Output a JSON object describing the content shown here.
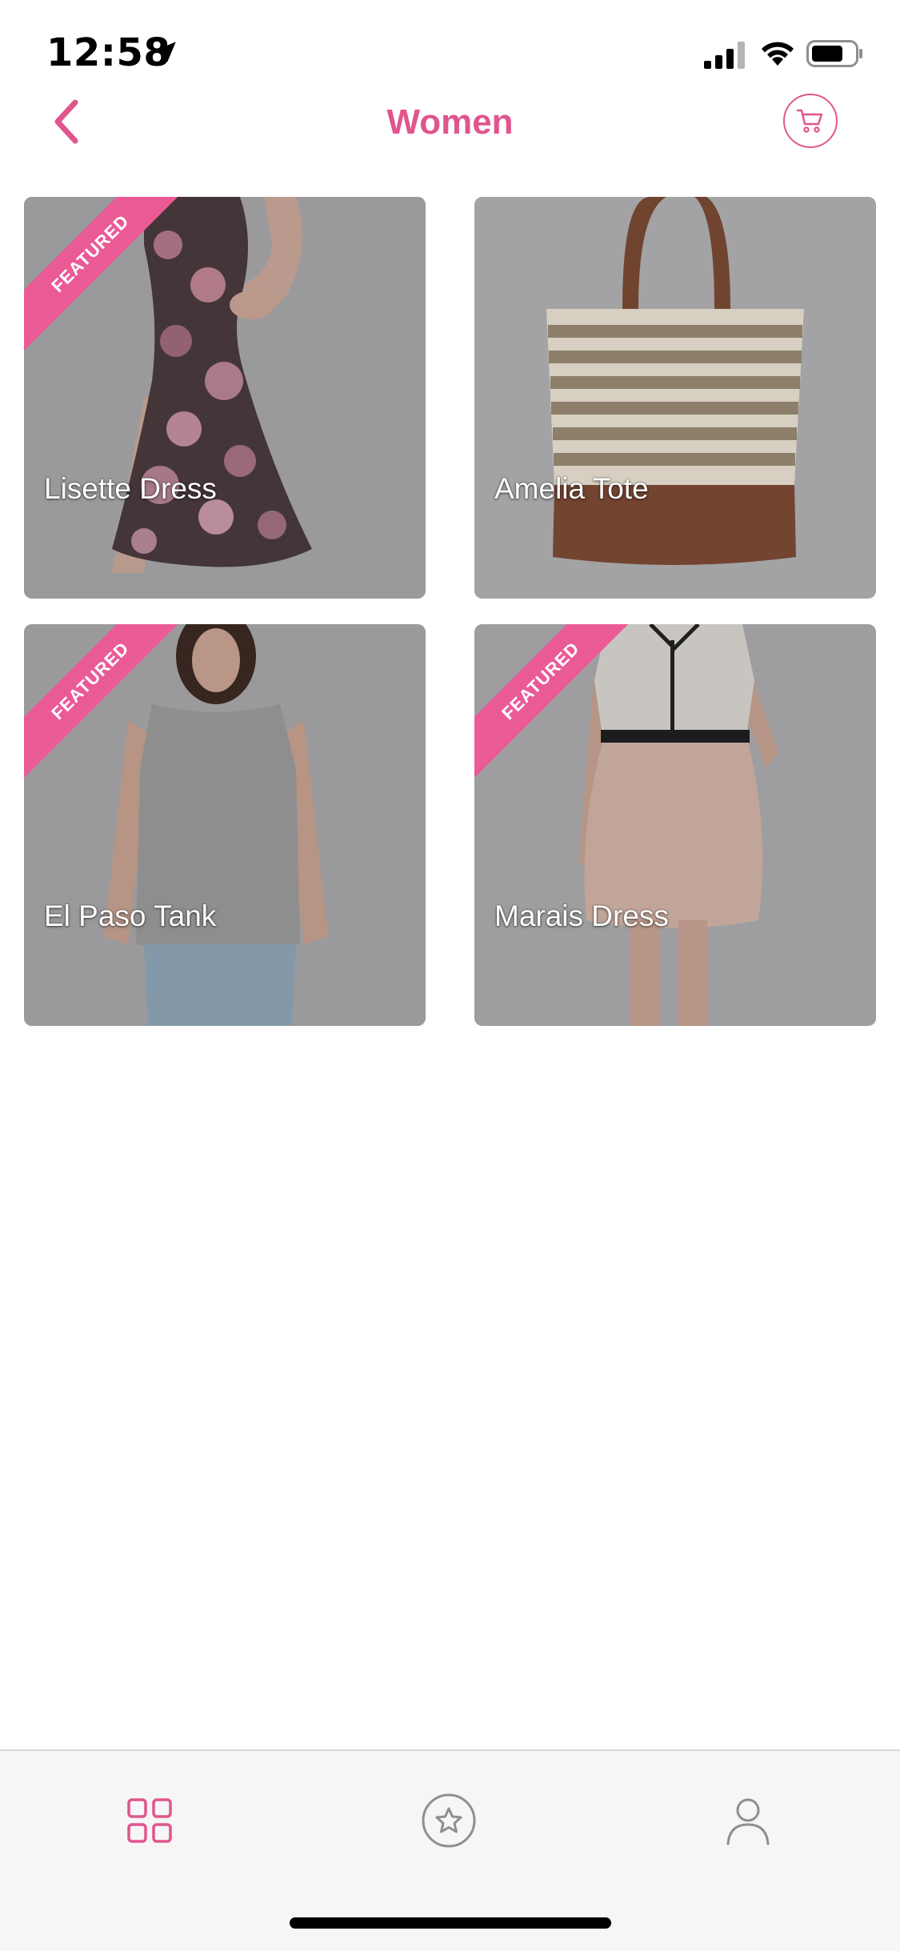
{
  "status_bar": {
    "time": "12:58"
  },
  "header": {
    "title": "Women"
  },
  "products": [
    {
      "name": "Lisette Dress",
      "featured": true,
      "badge": "FEATURED"
    },
    {
      "name": "Amelia Tote",
      "featured": false
    },
    {
      "name": "El Paso Tank",
      "featured": true,
      "badge": "FEATURED"
    },
    {
      "name": "Marais Dress",
      "featured": true,
      "badge": "FEATURED"
    }
  ],
  "tab_bar": {
    "items": [
      {
        "icon": "grid-icon",
        "active": true
      },
      {
        "icon": "star-icon",
        "active": false
      },
      {
        "icon": "user-icon",
        "active": false
      }
    ]
  },
  "colors": {
    "accent": "#e0558d",
    "ribbon": "#ea5b96",
    "card_background": "#a9a9ab",
    "tab_bar_background": "#f6f6f6",
    "inactive_icon": "#8e8e93"
  }
}
